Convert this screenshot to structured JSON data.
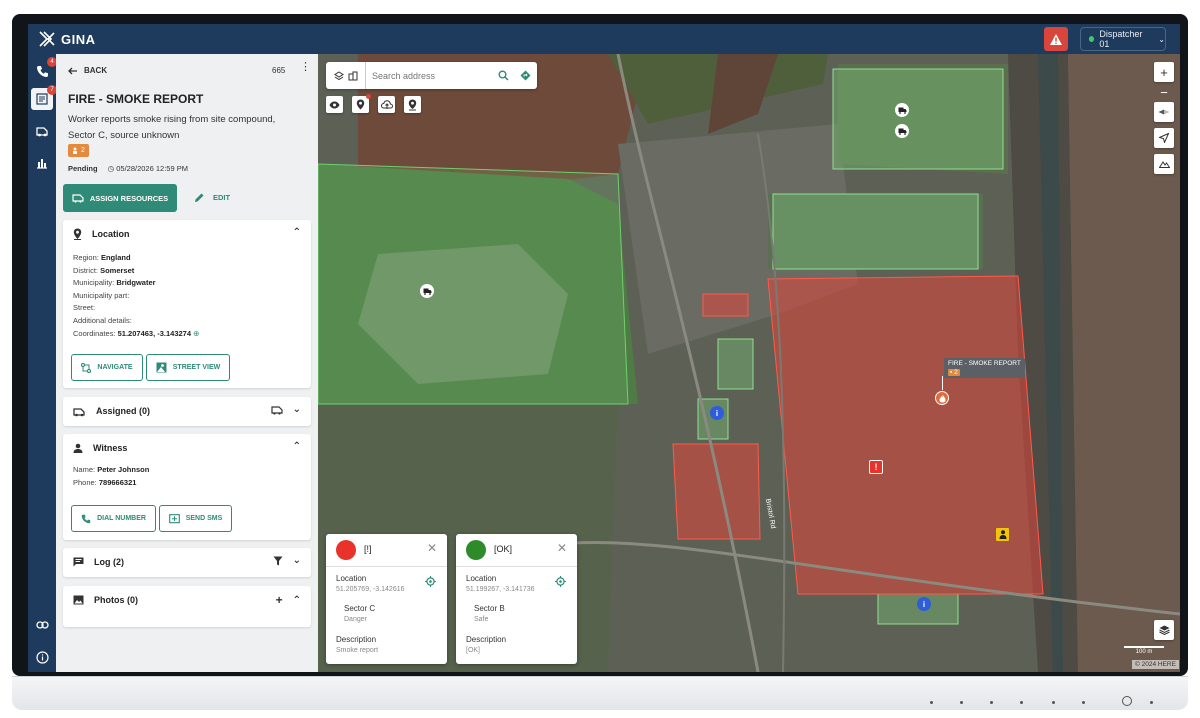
{
  "app": {
    "name": "GINA",
    "dispatcher": "Dispatcher 01"
  },
  "rail": {
    "calls_badge": "4",
    "incidents_badge": "7"
  },
  "panel": {
    "back_label": "BACK",
    "incident_number": "665",
    "title": "FIRE - SMOKE REPORT",
    "description": "Worker reports smoke rising from site compound, Sector C, source unknown",
    "chip_count": "2",
    "status": "Pending",
    "datetime": "05/28/2026 12:59 PM",
    "assign_label": "ASSIGN RESOURCES",
    "edit_label": "EDIT"
  },
  "location": {
    "title": "Location",
    "region_label": "Region:",
    "region": "England",
    "district_label": "District:",
    "district": "Somerset",
    "municipality_label": "Municipality:",
    "municipality": "Bridgwater",
    "municipality_part_label": "Municipality part:",
    "street_label": "Street:",
    "additional_label": "Additional details:",
    "coordinates_label": "Coordinates:",
    "coordinates": "51.207463, -3.143274",
    "navigate_label": "NAVIGATE",
    "street_view_label": "STREET VIEW"
  },
  "assigned": {
    "title": "Assigned (0)"
  },
  "witness": {
    "title": "Witness",
    "name_label": "Name:",
    "name": "Peter Johnson",
    "phone_label": "Phone:",
    "phone": "789666321",
    "dial_label": "DIAL NUMBER",
    "sms_label": "SEND SMS"
  },
  "log": {
    "title": "Log (2)"
  },
  "photos": {
    "title": "Photos (0)"
  },
  "map": {
    "search_placeholder": "Search address",
    "tooltip_title": "FIRE - SMOKE REPORT",
    "tooltip_chip": "2",
    "road_label": "Bristol Rd",
    "scale_label": "100 m",
    "copyright": "© 2024 HERE"
  },
  "popups": [
    {
      "title": "[!]",
      "color": "#e8322a",
      "location_label": "Location",
      "coords": "51.205769, -3.142616",
      "sector": "Sector C",
      "state": "Danger",
      "description_label": "Description",
      "description": "Smoke report"
    },
    {
      "title": "[OK]",
      "color": "#2f8a2a",
      "location_label": "Location",
      "coords": "51.199267, -3.141736",
      "sector": "Sector B",
      "state": "Safe",
      "description_label": "Description",
      "description": "[OK]"
    }
  ],
  "colors": {
    "brand": "#1e3a5c",
    "accent": "#2f8a78",
    "danger": "#d8453a",
    "chip": "#e58a3c"
  }
}
